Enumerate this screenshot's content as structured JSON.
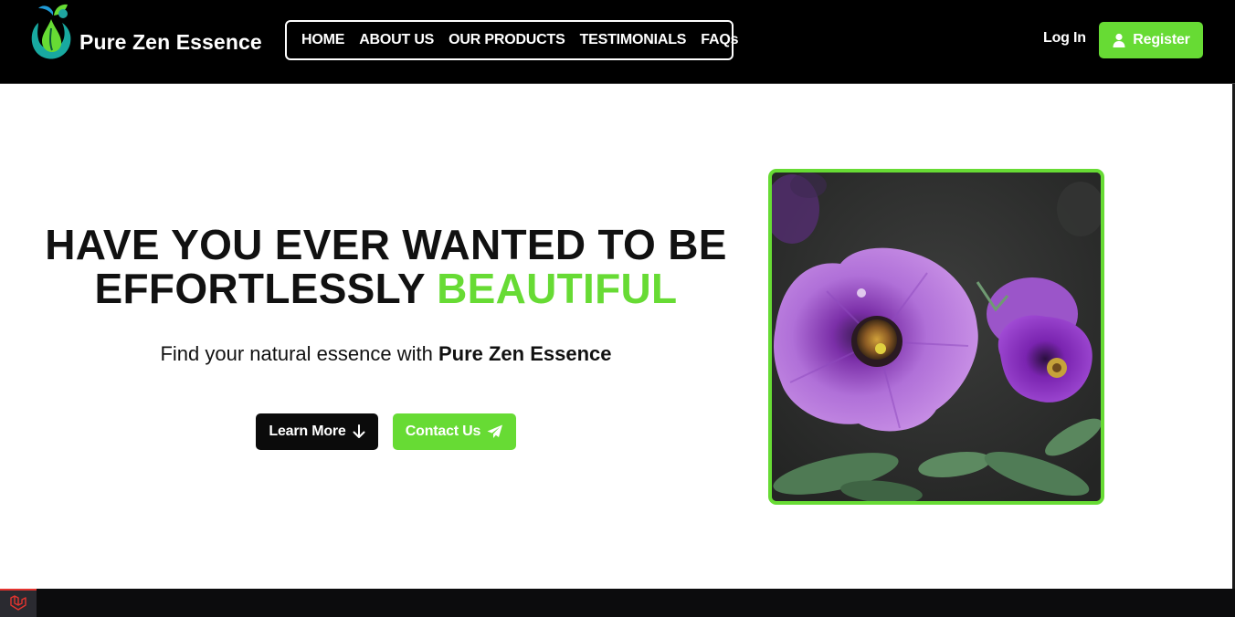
{
  "brand": {
    "name": "Pure Zen Essence",
    "logo_icon": "leaf-drop-logo-icon"
  },
  "nav": {
    "items": [
      {
        "label": "HOME"
      },
      {
        "label": "ABOUT US"
      },
      {
        "label": "OUR PRODUCTS"
      },
      {
        "label": "TESTIMONIALS"
      },
      {
        "label": "FAQs"
      }
    ]
  },
  "auth": {
    "login_label": "Log In",
    "register_label": "Register",
    "register_icon": "user-icon"
  },
  "hero": {
    "title_part1": "HAVE YOU EVER WANTED TO BE",
    "title_part2": "EFFORTLESSLY",
    "title_accent": "BEAUTIFUL",
    "subtitle_prefix": "Find your natural essence with",
    "subtitle_brand": "Pure Zen Essence",
    "learn_more_label": "Learn More",
    "learn_more_icon": "arrow-down-icon",
    "contact_label": "Contact Us",
    "contact_icon": "paper-plane-icon",
    "image": "purple-petunia-flowers-photo"
  },
  "colors": {
    "accent": "#67db34",
    "navbar_bg": "#000000",
    "dark_button": "#0b0b0b",
    "footer": "#0c0c0d",
    "debug_badge_border": "#e3342f"
  }
}
